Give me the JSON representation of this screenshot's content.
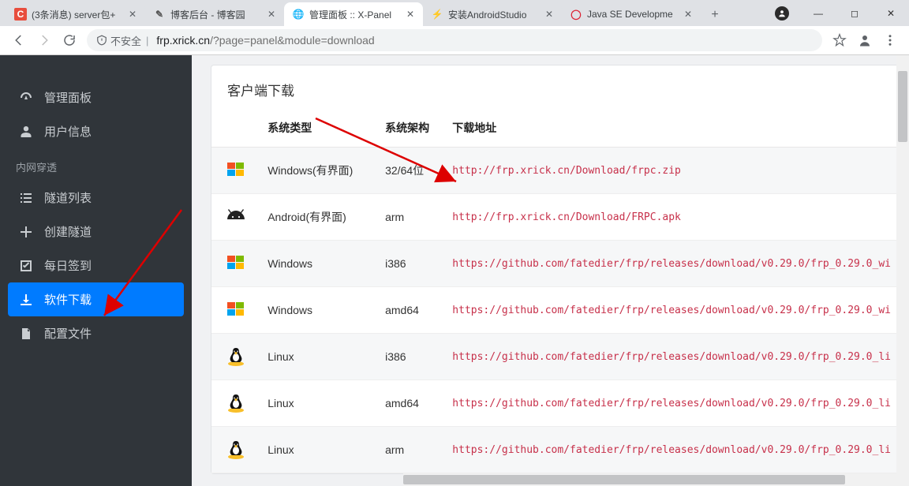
{
  "browser": {
    "tabs": [
      {
        "title": "(3条消息) server包+",
        "favicon": "C",
        "favbg": "#e84d3d",
        "favfg": "#fff"
      },
      {
        "title": "博客后台 - 博客园",
        "favicon": "✎",
        "favbg": "transparent",
        "favfg": "#555"
      },
      {
        "title": "管理面板 :: X-Panel",
        "favicon": "🌐",
        "favbg": "transparent",
        "favfg": "#555",
        "active": true
      },
      {
        "title": "安装AndroidStudio",
        "favicon": "⚡",
        "favbg": "transparent",
        "favfg": "#e8a33d"
      },
      {
        "title": "Java SE Developme",
        "favicon": "◯",
        "favbg": "transparent",
        "favfg": "#d23"
      }
    ],
    "secure_label": "不安全",
    "url_host": "frp.xrick.cn",
    "url_path": "/?page=panel&module=download"
  },
  "sidebar": {
    "top": [
      {
        "icon": "dashboard",
        "label": "管理面板"
      },
      {
        "icon": "user",
        "label": "用户信息"
      }
    ],
    "category": "内网穿透",
    "items": [
      {
        "icon": "list",
        "label": "隧道列表"
      },
      {
        "icon": "plus",
        "label": "创建隧道"
      },
      {
        "icon": "check",
        "label": "每日签到"
      },
      {
        "icon": "download",
        "label": "软件下载",
        "active": true
      },
      {
        "icon": "file",
        "label": "配置文件"
      }
    ]
  },
  "card": {
    "title": "客户端下载",
    "headers": {
      "sys": "系统类型",
      "arch": "系统架构",
      "url": "下载地址"
    },
    "rows": [
      {
        "os": "windows",
        "sys": "Windows(有界面)",
        "arch": "32/64位",
        "url": "http://frp.xrick.cn/Download/frpc.zip"
      },
      {
        "os": "android",
        "sys": "Android(有界面)",
        "arch": "arm",
        "url": "http://frp.xrick.cn/Download/FRPC.apk"
      },
      {
        "os": "windows",
        "sys": "Windows",
        "arch": "i386",
        "url": "https://github.com/fatedier/frp/releases/download/v0.29.0/frp_0.29.0_wi"
      },
      {
        "os": "windows",
        "sys": "Windows",
        "arch": "amd64",
        "url": "https://github.com/fatedier/frp/releases/download/v0.29.0/frp_0.29.0_wi"
      },
      {
        "os": "linux",
        "sys": "Linux",
        "arch": "i386",
        "url": "https://github.com/fatedier/frp/releases/download/v0.29.0/frp_0.29.0_li"
      },
      {
        "os": "linux",
        "sys": "Linux",
        "arch": "amd64",
        "url": "https://github.com/fatedier/frp/releases/download/v0.29.0/frp_0.29.0_li"
      },
      {
        "os": "linux",
        "sys": "Linux",
        "arch": "arm",
        "url": "https://github.com/fatedier/frp/releases/download/v0.29.0/frp_0.29.0_li"
      }
    ]
  }
}
